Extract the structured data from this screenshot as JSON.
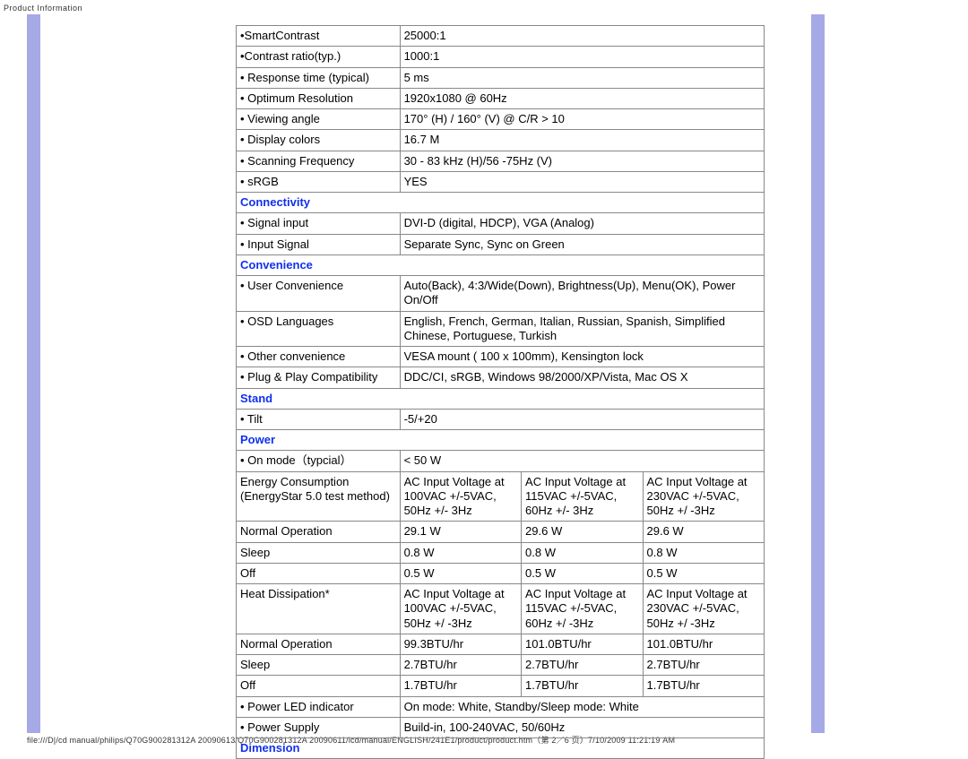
{
  "header": "Product Information",
  "footer": "file:///D|/cd manual/philips/Q70G900281312A 20090613/Q70G900281312A 20090611/lcd/manual/ENGLISH/241E1/product/product.htm（第 2／6 页）7/10/2009 11:21:19 AM",
  "rows": [
    {
      "type": "kv",
      "label": "•SmartContrast",
      "value": "25000:1"
    },
    {
      "type": "kv",
      "label": "•Contrast ratio(typ.)",
      "value": "1000:1"
    },
    {
      "type": "kv",
      "label": "• Response time (typical)",
      "value": "5 ms"
    },
    {
      "type": "kv",
      "label": "• Optimum Resolution",
      "value": "1920x1080 @ 60Hz"
    },
    {
      "type": "kv",
      "label": "• Viewing angle",
      "value": "170° (H) / 160° (V) @ C/R > 10"
    },
    {
      "type": "kv",
      "label": "• Display colors",
      "value": "16.7 M"
    },
    {
      "type": "kv",
      "label": "• Scanning Frequency",
      "value": "30 - 83 kHz (H)/56 -75Hz (V)"
    },
    {
      "type": "kv",
      "label": "• sRGB",
      "value": "  YES"
    },
    {
      "type": "section",
      "label": "Connectivity"
    },
    {
      "type": "kv",
      "label": "• Signal input",
      "value": "DVI-D (digital, HDCP), VGA (Analog)"
    },
    {
      "type": "kv",
      "label": "• Input Signal",
      "value": "Separate Sync, Sync on Green"
    },
    {
      "type": "section",
      "label": "Convenience"
    },
    {
      "type": "kv",
      "label": "• User Convenience",
      "value": "Auto(Back), 4:3/Wide(Down), Brightness(Up), Menu(OK), Power On/Off"
    },
    {
      "type": "kv",
      "label": "• OSD Languages",
      "value": "English, French, German, Italian, Russian, Spanish, Simplified Chinese, Portuguese, Turkish"
    },
    {
      "type": "kv",
      "label": "• Other convenience",
      "value": "VESA mount ( 100 x 100mm), Kensington lock"
    },
    {
      "type": "kv",
      "label": "• Plug & Play Compatibility",
      "value": "DDC/CI, sRGB, Windows 98/2000/XP/Vista, Mac OS X"
    },
    {
      "type": "section",
      "label": "Stand"
    },
    {
      "type": "kv",
      "label": "• Tilt",
      "value": "-5/+20"
    },
    {
      "type": "section",
      "label": "Power"
    },
    {
      "type": "kv",
      "label": "• On mode（typcial）",
      "value": "< 50 W"
    },
    {
      "type": "four",
      "c1": "Energy Consumption (EnergyStar 5.0 test method)",
      "c2": "AC Input Voltage at 100VAC +/-5VAC, 50Hz +/- 3Hz",
      "c3": "AC Input Voltage at 115VAC +/-5VAC, 60Hz +/- 3Hz",
      "c4": "AC Input Voltage at 230VAC +/-5VAC, 50Hz +/ -3Hz"
    },
    {
      "type": "four",
      "c1": "Normal Operation",
      "c2": "29.1 W",
      "c3": "29.6 W",
      "c4": "29.6 W"
    },
    {
      "type": "four",
      "c1": "Sleep",
      "c2": "0.8 W",
      "c3": "0.8 W",
      "c4": "0.8 W"
    },
    {
      "type": "four",
      "c1": "Off",
      "c2": "0.5 W",
      "c3": "0.5 W",
      "c4": "0.5 W"
    },
    {
      "type": "four",
      "c1": "Heat Dissipation*",
      "c2": "AC Input Voltage at 100VAC +/-5VAC, 50Hz +/ -3Hz",
      "c3": "AC Input Voltage at 115VAC +/-5VAC, 60Hz +/ -3Hz",
      "c4": "AC Input Voltage at 230VAC +/-5VAC, 50Hz +/ -3Hz"
    },
    {
      "type": "four",
      "c1": "Normal Operation",
      "c2": "99.3BTU/hr",
      "c3": "101.0BTU/hr",
      "c4": "101.0BTU/hr"
    },
    {
      "type": "four",
      "c1": "Sleep",
      "c2": "2.7BTU/hr",
      "c3": "2.7BTU/hr",
      "c4": "2.7BTU/hr"
    },
    {
      "type": "four",
      "c1": "Off",
      "c2": "1.7BTU/hr",
      "c3": "1.7BTU/hr",
      "c4": "1.7BTU/hr"
    },
    {
      "type": "kv",
      "label": "• Power LED indicator",
      "value": "On mode: White, Standby/Sleep mode: White"
    },
    {
      "type": "kv",
      "label": "• Power Supply",
      "value": "Build-in, 100-240VAC, 50/60Hz"
    },
    {
      "type": "section",
      "label": "Dimension"
    }
  ]
}
